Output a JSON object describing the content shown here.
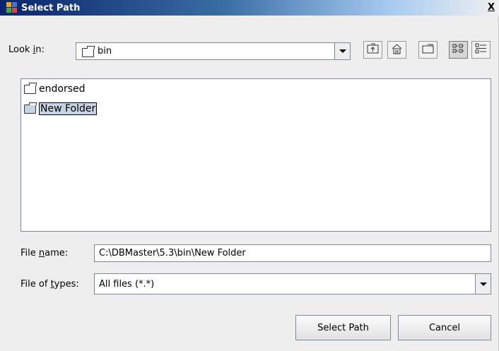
{
  "title": {
    "text": "Select Path",
    "icon": "app-icon",
    "close_glyph": "X"
  },
  "lookin": {
    "label_prefix": "Look ",
    "label_mnemonic": "i",
    "label_suffix": "n:",
    "value": "bin",
    "icon": "folder-icon"
  },
  "toolbar": {
    "buttons": [
      {
        "name": "up-one-level-button",
        "icon": "folder-up-icon"
      },
      {
        "name": "home-button",
        "icon": "home-icon"
      },
      {
        "name": "new-folder-button",
        "icon": "new-folder-icon"
      },
      {
        "name": "list-view-button",
        "icon": "list-view-icon",
        "pressed": true
      },
      {
        "name": "details-view-button",
        "icon": "details-view-icon",
        "pressed": false
      }
    ]
  },
  "files": [
    {
      "name": "endorsed",
      "selected": false,
      "editing": false
    },
    {
      "name": "New Folder",
      "selected": true,
      "editing": true
    }
  ],
  "filename": {
    "label_prefix": "File ",
    "label_mnemonic": "n",
    "label_suffix": "ame:",
    "value": "C:\\DBMaster\\5.3\\bin\\New Folder"
  },
  "filetypes": {
    "label_prefix": "File of ",
    "label_mnemonic": "t",
    "label_suffix": "ypes:",
    "value": "All files (*.*)"
  },
  "buttons": {
    "select": "Select Path",
    "cancel": "Cancel"
  },
  "colors": {
    "selection": "#c5d3e5",
    "titlebar_start": "#0a246a",
    "dialog_bg": "#eeeeee"
  }
}
